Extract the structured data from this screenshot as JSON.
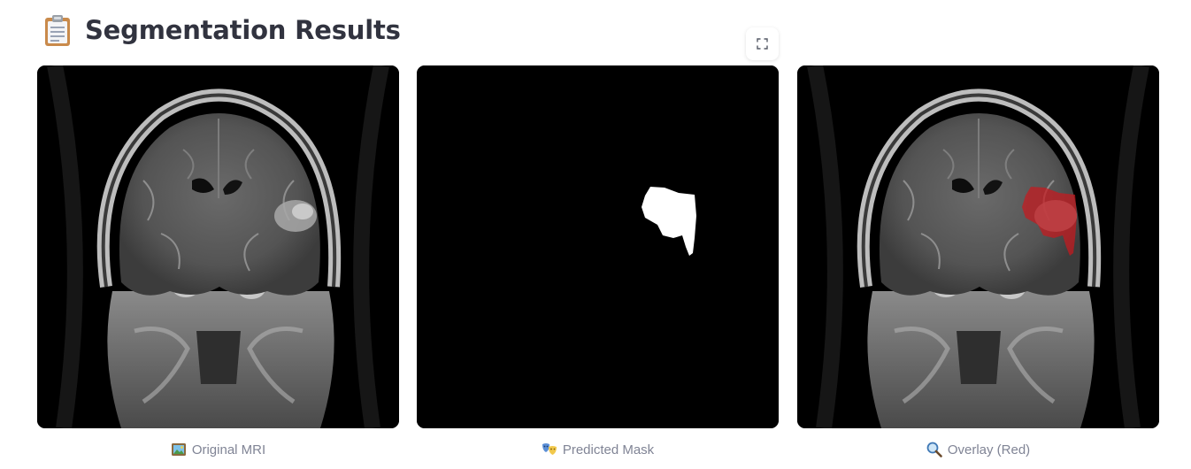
{
  "header": {
    "title": "Segmentation Results",
    "icon": "clipboard-icon"
  },
  "toolbar": {
    "fullscreen_icon": "fullscreen-expand-icon"
  },
  "images": [
    {
      "caption": "Original MRI",
      "icon": "framed-picture-icon"
    },
    {
      "caption": "Predicted Mask",
      "icon": "performing-arts-icon"
    },
    {
      "caption": "Overlay (Red)",
      "icon": "magnifying-glass-icon"
    }
  ],
  "colors": {
    "title": "#31333f",
    "caption": "#808495",
    "overlay": "#c8191e",
    "mask": "#ffffff",
    "background": "#000000"
  }
}
